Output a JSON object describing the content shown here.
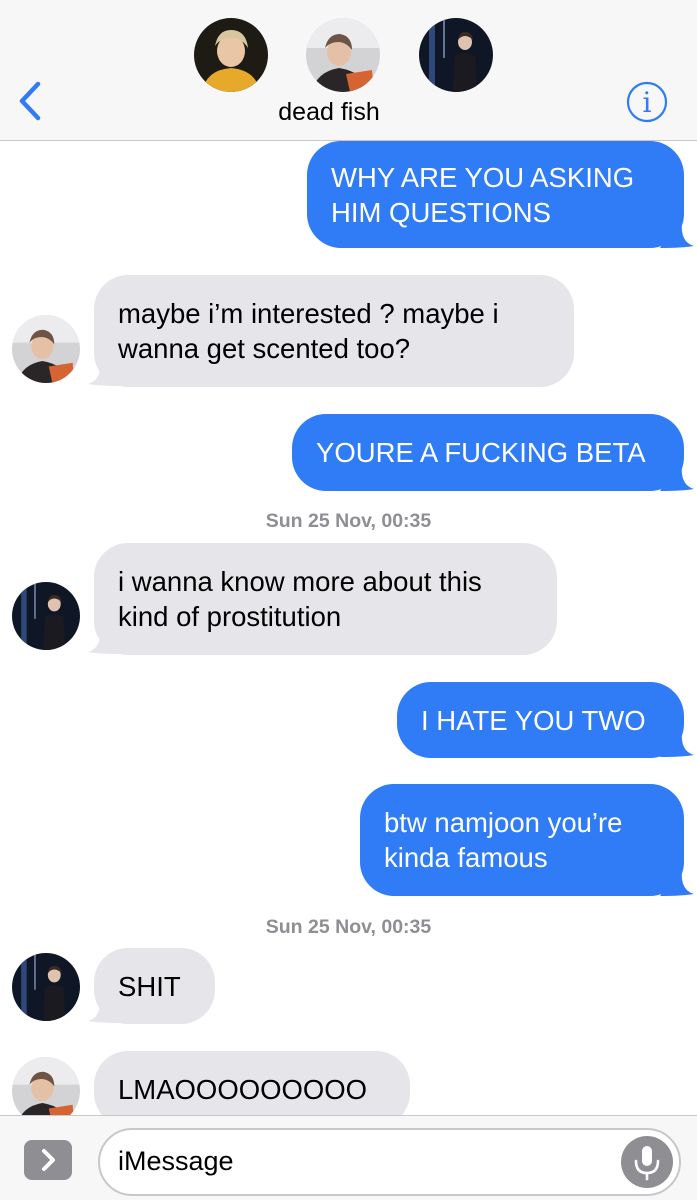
{
  "header": {
    "group_name": "dead fish",
    "back_icon": "chevron-left-icon",
    "info_icon": "info-circle-icon",
    "info_glyph": "i",
    "accent_color": "#2f7cf6"
  },
  "messages": [
    {
      "direction": "outgoing",
      "lines": [
        "WHY ARE YOU ASKING",
        "HIM QUESTIONS"
      ]
    },
    {
      "direction": "incoming",
      "lines": [
        "maybe i’m interested ? maybe i",
        "wanna get scented too?"
      ]
    },
    {
      "direction": "outgoing",
      "lines": [
        "YOURE A FUCKING BETA"
      ]
    },
    {
      "direction": "incoming",
      "lines": [
        "i wanna know more about this",
        "kind of prostitution"
      ]
    },
    {
      "direction": "outgoing",
      "lines": [
        "I HATE YOU TWO"
      ]
    },
    {
      "direction": "outgoing",
      "lines": [
        "btw namjoon you’re",
        "kinda famous"
      ]
    },
    {
      "direction": "incoming",
      "lines": [
        "SHIT"
      ]
    },
    {
      "direction": "incoming",
      "lines": [
        "LMAOOOOOOOOO"
      ]
    }
  ],
  "timestamps": [
    {
      "day": "Sun 25 Nov,",
      "time": "00:35"
    },
    {
      "day": "Sun 25 Nov,",
      "time": "00:35"
    }
  ],
  "composer": {
    "placeholder": "iMessage",
    "apps_icon": "chevron-right-icon",
    "mic_icon": "microphone-icon"
  },
  "colors": {
    "outgoing_bubble": "#2f7cf6",
    "incoming_bubble": "#e5e5ea",
    "timestamp": "#8e8e93"
  }
}
